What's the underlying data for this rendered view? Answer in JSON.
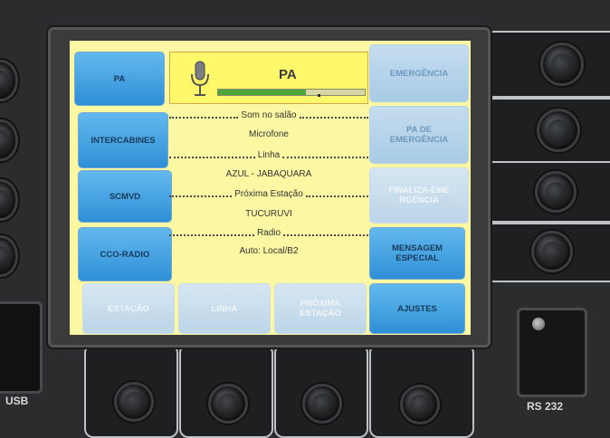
{
  "header": {
    "title": "PA",
    "mic_icon": "microphone-icon",
    "level_fraction": 0.6
  },
  "left_buttons": [
    {
      "label": "PA"
    },
    {
      "label": "INTERCABINES"
    },
    {
      "label": "SCMVD"
    },
    {
      "label": "CCO-RADIO"
    }
  ],
  "right_buttons": [
    {
      "label": "EMERGÊNCIA"
    },
    {
      "label": "PA DE EMERGÊNCIA"
    },
    {
      "label": "FINALIZA-EMERGÊNCIA"
    },
    {
      "label": "MENSAGEM ESPECIAL"
    },
    {
      "label": "AJUSTES"
    }
  ],
  "bottom_buttons": [
    {
      "label": "ESTAÇÃO"
    },
    {
      "label": "LINHA"
    },
    {
      "label": "PRÓXIMA ESTAÇÃO"
    }
  ],
  "info": {
    "som_no_salao": "Som no salão",
    "microfone": "Microfone",
    "linha_label": "Linha",
    "linha_value": "AZUL - JABAQUARA",
    "proxima_label": "Próxima Estação",
    "proxima_value": "TUCURUVI",
    "radio_label": "Radio",
    "radio_value": "Auto: Local/B2"
  },
  "hardware": {
    "usb_label": "USB",
    "rs232_label": "RS 232"
  }
}
